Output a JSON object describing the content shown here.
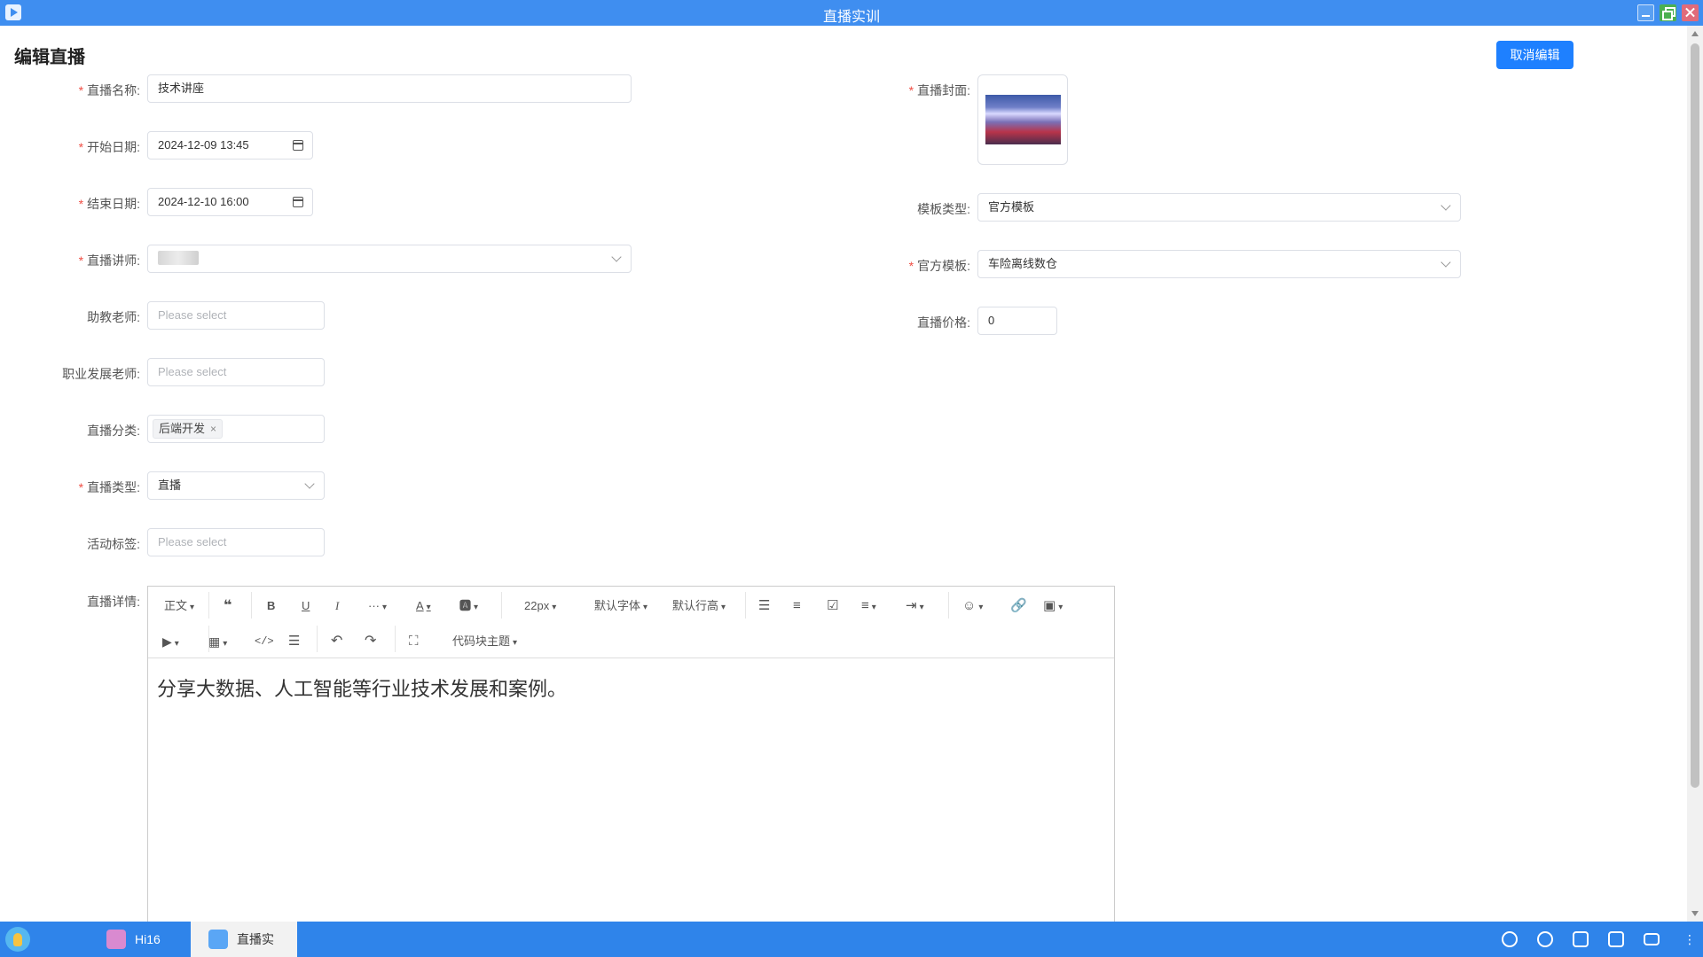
{
  "window": {
    "title": "直播实训"
  },
  "page": {
    "title": "编辑直播",
    "cancel_label": "取消编辑"
  },
  "form": {
    "name": {
      "label": "直播名称:",
      "required": true,
      "value": "技术讲座"
    },
    "start_date": {
      "label": "开始日期:",
      "required": true,
      "value": "2024-12-09 13:45"
    },
    "end_date": {
      "label": "结束日期:",
      "required": true,
      "value": "2024-12-10 16:00"
    },
    "lecturer": {
      "label": "直播讲师:",
      "required": true
    },
    "assistant": {
      "label": "助教老师:",
      "placeholder": "Please select"
    },
    "career_teacher": {
      "label": "职业发展老师:",
      "placeholder": "Please select"
    },
    "category": {
      "label": "直播分类:",
      "tags": [
        "后端开发"
      ]
    },
    "type": {
      "label": "直播类型:",
      "required": true,
      "value": "直播"
    },
    "activity_tags": {
      "label": "活动标签:",
      "placeholder": "Please select"
    },
    "details": {
      "label": "直播详情:"
    },
    "cover": {
      "label": "直播封面:",
      "required": true
    },
    "template_type": {
      "label": "模板类型:",
      "value": "官方模板"
    },
    "official_template": {
      "label": "官方模板:",
      "required": true,
      "value": "车险离线数仓"
    },
    "price": {
      "label": "直播价格:",
      "value": "0"
    }
  },
  "editor": {
    "toolbar": {
      "paragraph": "正文",
      "font_size": "22px",
      "font_family": "默认字体",
      "line_height": "默认行高",
      "more": "···",
      "code_theme": "代码块主题"
    },
    "content": "分享大数据、人工智能等行业技术发展和案例。"
  },
  "taskbar": {
    "items": [
      {
        "label": "Hi16",
        "active": false
      },
      {
        "label": "直播实",
        "active": true
      }
    ]
  },
  "colors": {
    "primary": "#1e80ff",
    "titlebar": "#3f8ef0",
    "taskbar": "#2f84ea",
    "required": "#f04f45"
  }
}
